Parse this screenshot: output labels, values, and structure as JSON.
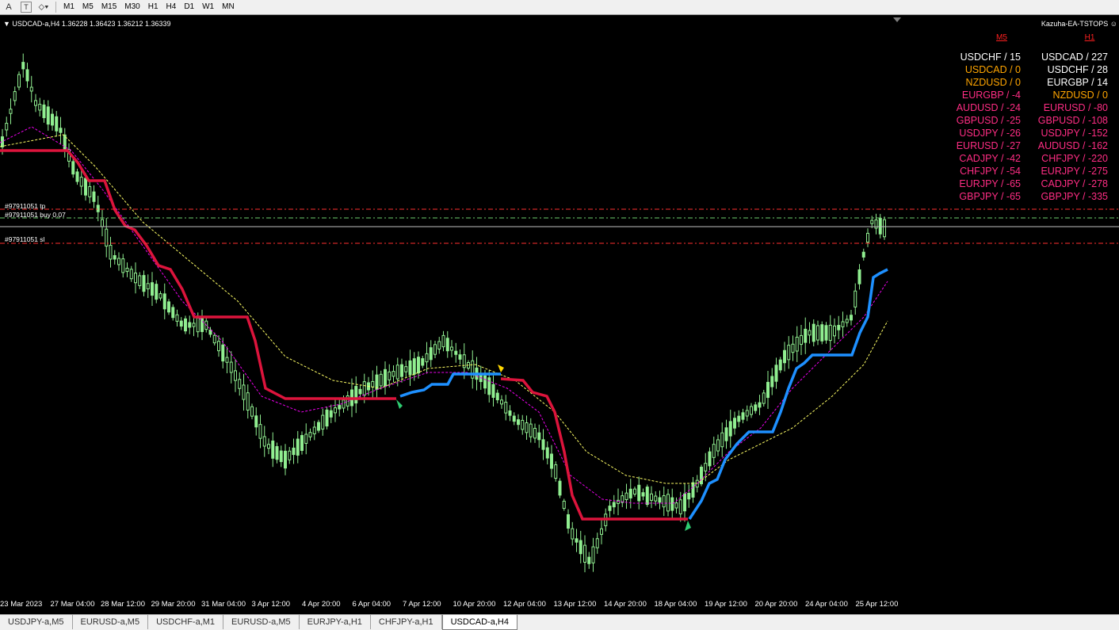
{
  "toolbar": {
    "icons": [
      "text-a-icon",
      "text-t-icon",
      "shapes-icon"
    ],
    "timeframes": [
      "M1",
      "M5",
      "M15",
      "M30",
      "H1",
      "H4",
      "D1",
      "W1",
      "MN"
    ]
  },
  "chart": {
    "info": "USDCAD-a,H4  1.36228 1.36423 1.36212 1.36339",
    "ea_label": "Kazuha-EA-TSTOPS",
    "trade_tp": "#97911051 tp",
    "trade_buy": "#97911051 buy 0.07",
    "trade_sl": "#97911051 sl",
    "xlabels": [
      "23 Mar 2023",
      "27 Mar 04:00",
      "28 Mar 12:00",
      "29 Mar 20:00",
      "31 Mar 04:00",
      "3 Apr 12:00",
      "4 Apr 20:00",
      "6 Apr 04:00",
      "7 Apr 12:00",
      "10 Apr 20:00",
      "12 Apr 04:00",
      "13 Apr 12:00",
      "14 Apr 20:00",
      "18 Apr 04:00",
      "19 Apr 12:00",
      "20 Apr 20:00",
      "24 Apr 04:00",
      "25 Apr 12:00"
    ],
    "colors": {
      "bull": "#90ee90",
      "band_down": "#dc143c",
      "band_up": "#1e90ff",
      "ma_slow": "#ffff66",
      "ma_fast": "#ee00ee",
      "tp_line": "#ff3030",
      "sl_line": "#ff3030",
      "buy_line": "#70d070"
    }
  },
  "strength": {
    "m5_header": "M5",
    "h1_header": "H1",
    "m5": [
      {
        "text": "USDCHF / 15",
        "color": "#ffffff"
      },
      {
        "text": "USDCAD / 0",
        "color": "#ffa500"
      },
      {
        "text": "NZDUSD / 0",
        "color": "#ffa500"
      },
      {
        "text": "EURGBP / -4",
        "color": "#ff2d84"
      },
      {
        "text": "AUDUSD / -24",
        "color": "#ff2d84"
      },
      {
        "text": "GBPUSD / -25",
        "color": "#ff2d84"
      },
      {
        "text": "USDJPY / -26",
        "color": "#ff2d84"
      },
      {
        "text": "EURUSD / -27",
        "color": "#ff2d84"
      },
      {
        "text": "CADJPY / -42",
        "color": "#ff2d84"
      },
      {
        "text": "CHFJPY / -54",
        "color": "#ff2d84"
      },
      {
        "text": "EURJPY / -65",
        "color": "#ff2d84"
      },
      {
        "text": "GBPJPY / -65",
        "color": "#ff2d84"
      }
    ],
    "h1": [
      {
        "text": "USDCAD / 227",
        "color": "#ffffff"
      },
      {
        "text": "USDCHF / 28",
        "color": "#ffffff"
      },
      {
        "text": "EURGBP / 14",
        "color": "#ffffff"
      },
      {
        "text": "NZDUSD / 0",
        "color": "#ffa500"
      },
      {
        "text": "EURUSD / -80",
        "color": "#ff2d84"
      },
      {
        "text": "GBPUSD / -108",
        "color": "#ff2d84"
      },
      {
        "text": "USDJPY / -152",
        "color": "#ff2d84"
      },
      {
        "text": "AUDUSD / -162",
        "color": "#ff2d84"
      },
      {
        "text": "CHFJPY / -220",
        "color": "#ff2d84"
      },
      {
        "text": "EURJPY / -275",
        "color": "#ff2d84"
      },
      {
        "text": "CADJPY / -278",
        "color": "#ff2d84"
      },
      {
        "text": "GBPJPY / -335",
        "color": "#ff2d84"
      }
    ]
  },
  "tabs": [
    "USDJPY-a,M5",
    "EURUSD-a,M5",
    "USDCHF-a,M1",
    "EURUSD-a,M5",
    "EURJPY-a,H1",
    "CHFJPY-a,H1",
    "USDCAD-a,H4"
  ],
  "active_tab": 6
}
